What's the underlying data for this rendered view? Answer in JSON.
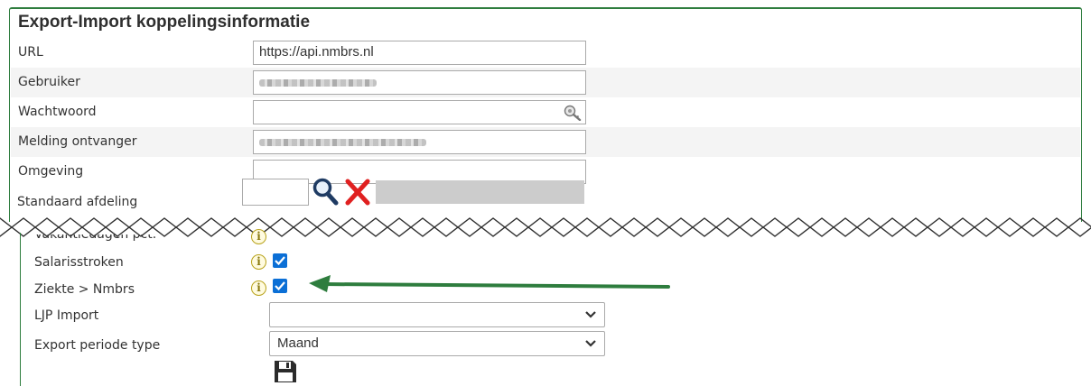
{
  "section": {
    "title": "Export-Import koppelingsinformatie"
  },
  "fields": {
    "url": {
      "label": "URL",
      "value": "https://api.nmbrs.nl"
    },
    "gebruiker": {
      "label": "Gebruiker",
      "value": ""
    },
    "wachtwoord": {
      "label": "Wachtwoord",
      "value": "",
      "icon": "key-icon"
    },
    "melding": {
      "label": "Melding ontvanger",
      "value": ""
    },
    "omgeving": {
      "label": "Omgeving",
      "value": ""
    },
    "afdeling": {
      "label": "Standaard afdeling",
      "code": "",
      "name": ""
    }
  },
  "options": {
    "vakantiedagen": {
      "label": "Vakantiedagen pct.",
      "checked": true
    },
    "salarisstroken": {
      "label": "Salarisstroken",
      "checked": true
    },
    "ziekte": {
      "label": "Ziekte > Nmbrs",
      "checked": true
    }
  },
  "selects": {
    "ljp": {
      "label": "LJP Import",
      "value": ""
    },
    "periode": {
      "label": "Export periode type",
      "value": "Maand"
    }
  },
  "icons": {
    "lookup": "magnifier-icon",
    "clear": "red-x-icon",
    "info": "info-icon",
    "save": "floppy-disk-icon"
  },
  "colors": {
    "panel_border": "#2e7d3e",
    "arrow": "#2e7d3e",
    "checkbox": "#0b6fd6",
    "clear_x": "#e02020"
  }
}
